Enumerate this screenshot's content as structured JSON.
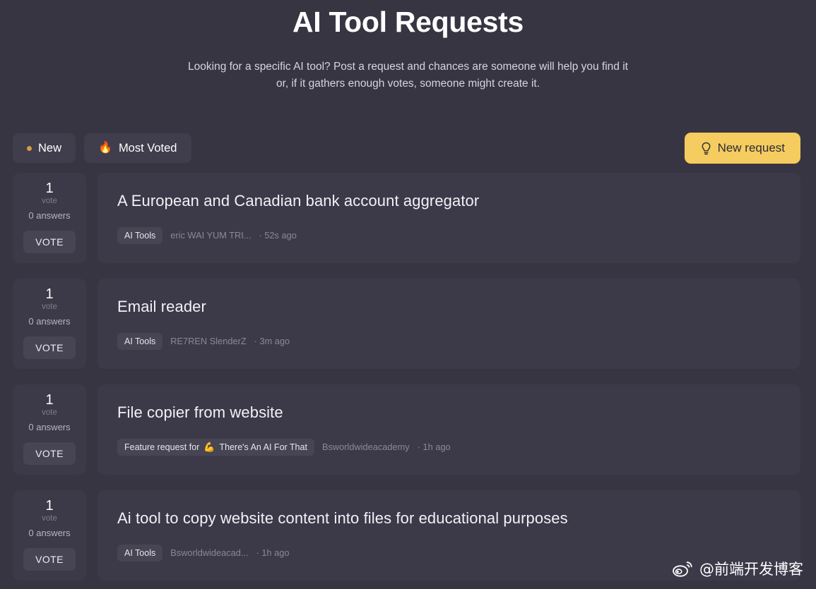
{
  "header": {
    "title": "AI Tool Requests",
    "subtitle": "Looking for a specific AI tool? Post a request and chances are someone will help you find it or, if it gathers enough votes, someone might create it."
  },
  "toolbar": {
    "tabs": [
      {
        "label": "New",
        "icon": "dot-icon",
        "active": true
      },
      {
        "label": "Most Voted",
        "icon": "fire-emoji",
        "emoji": "🔥",
        "active": false
      }
    ],
    "new_request_label": "New request",
    "new_request_icon": "lightbulb-icon",
    "accent_color": "#f5cc5f"
  },
  "labels": {
    "vote_button": "VOTE",
    "vote_word": "vote"
  },
  "requests": [
    {
      "votes": "1",
      "vote_word": "vote",
      "answers": "0 answers",
      "title": "A European and Canadian bank account aggregator",
      "badge_prefix": "",
      "badge_emoji": "",
      "badge_label": "AI Tools",
      "author": "eric WAI YUM TRI...",
      "time": "· 52s ago"
    },
    {
      "votes": "1",
      "vote_word": "vote",
      "answers": "0 answers",
      "title": "Email reader",
      "badge_prefix": "",
      "badge_emoji": "",
      "badge_label": "AI Tools",
      "author": "RE7REN SlenderZ",
      "time": "· 3m ago"
    },
    {
      "votes": "1",
      "vote_word": "vote",
      "answers": "0 answers",
      "title": "File copier from website",
      "badge_prefix": "Feature request for",
      "badge_emoji": "💪",
      "badge_label": "There's An AI For That",
      "author": "Bsworldwideacademy",
      "time": "· 1h ago"
    },
    {
      "votes": "1",
      "vote_word": "vote",
      "answers": "0 answers",
      "title": "Ai tool to copy website content into files for educational purposes",
      "badge_prefix": "",
      "badge_emoji": "",
      "badge_label": "AI Tools",
      "author": "Bsworldwideacad...",
      "time": "· 1h ago"
    }
  ],
  "watermark": {
    "text": "@前端开发博客",
    "icon": "weibo-icon"
  }
}
